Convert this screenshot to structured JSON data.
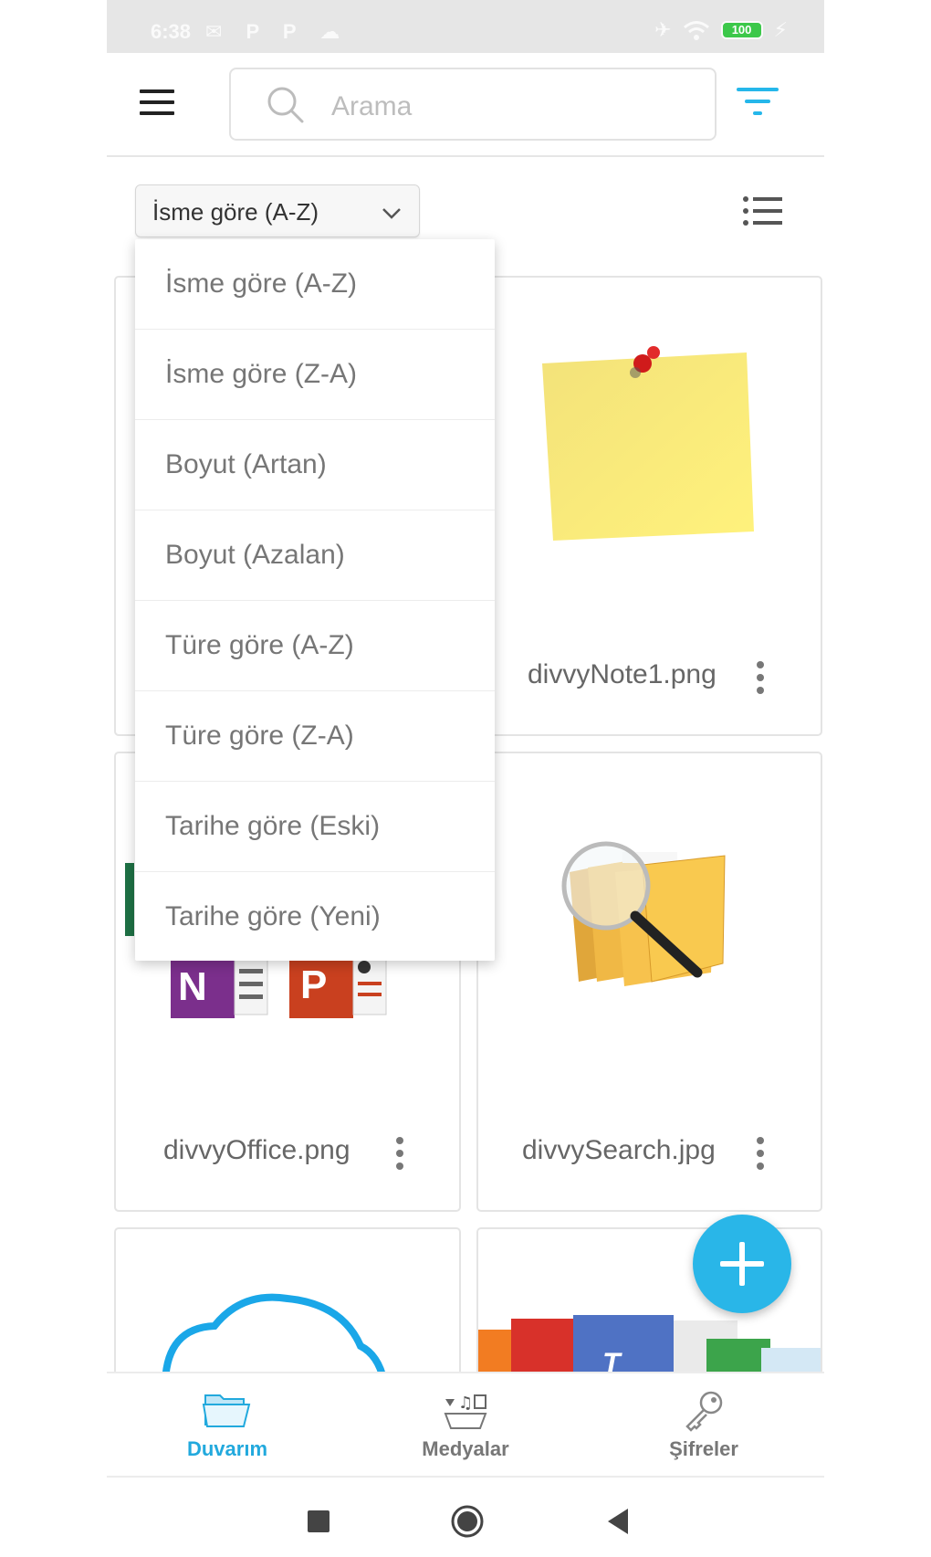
{
  "status_bar": {
    "time": "6:38",
    "left_icons": "✉ P P ☁",
    "battery": "100"
  },
  "search": {
    "placeholder": "Arama"
  },
  "sort": {
    "selected": "İsme göre (A-Z)",
    "options": [
      "İsme göre (A-Z)",
      "İsme göre (Z-A)",
      "Boyut (Artan)",
      "Boyut (Azalan)",
      "Türe göre (A-Z)",
      "Türe göre (Z-A)",
      "Tarihe göre (Eski)",
      "Tarihe göre (Yeni)"
    ]
  },
  "files": [
    {
      "name": "divvyNote1.png",
      "thumb": "sticky-note"
    },
    {
      "name": "divvyOffice.png",
      "thumb": "office-apps"
    },
    {
      "name": "divvySearch.jpg",
      "thumb": "folder-search"
    },
    {
      "name": "",
      "thumb": "cloud"
    },
    {
      "name": "",
      "thumb": "documents"
    }
  ],
  "bottom_nav": {
    "items": [
      {
        "label": "Duvarım",
        "icon": "folder-icon",
        "active": true
      },
      {
        "label": "Medyalar",
        "icon": "media-icon",
        "active": false
      },
      {
        "label": "Şifreler",
        "icon": "key-icon",
        "active": false
      }
    ]
  },
  "colors": {
    "accent": "#29b6e8",
    "active_nav": "#22a9dd",
    "status_bar": "#e6e6e6",
    "battery": "#3cc84a"
  }
}
